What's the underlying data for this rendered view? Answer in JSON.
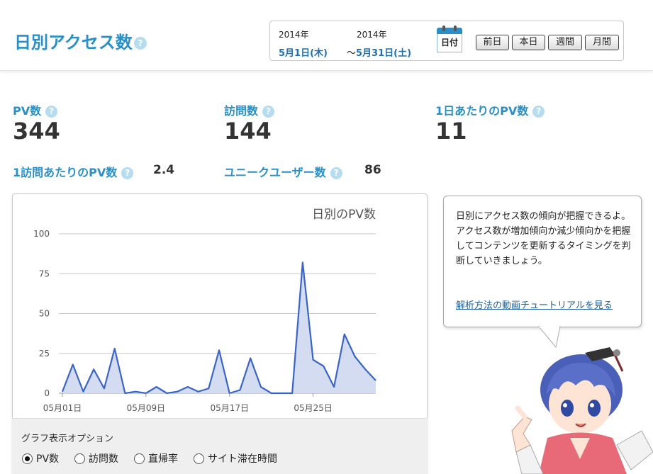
{
  "header": {
    "title": "日別アクセス数",
    "help": "?",
    "date_range": {
      "start_year": "2014年",
      "start_day": "5月1日(木)",
      "end_year": "2014年",
      "end_day": "5月31日(土)",
      "separator": "〜"
    },
    "calendar_label": "日付",
    "buttons": [
      "前日",
      "本日",
      "週間",
      "月間"
    ]
  },
  "stats": {
    "pv_label": "PV数",
    "pv_value": "344",
    "visits_label": "訪問数",
    "visits_value": "144",
    "pv_per_day_label": "1日あたりのPV数",
    "pv_per_day_value": "11",
    "pv_per_visit_label": "1訪問あたりのPV数",
    "pv_per_visit_value": "2.4",
    "unique_users_label": "ユニークユーザー数",
    "unique_users_value": "86"
  },
  "chart_data": {
    "type": "area",
    "title": "日別のPV数",
    "xlabel": "",
    "ylabel": "",
    "ylim": [
      0,
      100
    ],
    "yticks": [
      0,
      25,
      50,
      75,
      100
    ],
    "x_tick_labels": [
      {
        "label": "05月01日",
        "day": 1
      },
      {
        "label": "05月09日",
        "day": 9
      },
      {
        "label": "05月17日",
        "day": 17
      },
      {
        "label": "05月25日",
        "day": 25
      }
    ],
    "x": [
      1,
      2,
      3,
      4,
      5,
      6,
      7,
      8,
      9,
      10,
      11,
      12,
      13,
      14,
      15,
      16,
      17,
      18,
      19,
      20,
      21,
      22,
      23,
      24,
      25,
      26,
      27,
      28,
      29,
      30,
      31
    ],
    "series": [
      {
        "values": [
          1,
          18,
          1,
          15,
          3,
          28,
          0,
          1,
          0,
          4,
          0,
          1,
          4,
          1,
          3,
          27,
          0,
          2,
          22,
          4,
          0,
          0,
          0,
          82,
          21,
          17,
          4,
          37,
          23,
          15,
          8
        ]
      }
    ],
    "line_color": "#3a64c8",
    "fill_color": "#d3dcf1",
    "grid": true
  },
  "options": {
    "title": "グラフ表示オプション",
    "radios": [
      {
        "label": "PV数",
        "selected": true
      },
      {
        "label": "訪問数",
        "selected": false
      },
      {
        "label": "直帰率",
        "selected": false
      },
      {
        "label": "サイト滞在時間",
        "selected": false
      }
    ]
  },
  "tip": {
    "text": "日別にアクセス数の傾向が把握できるよ。\nアクセス数が増加傾向か減少傾向かを把握してコンテンツを更新するタイミングを判断していきましょう。",
    "link": "解析方法の動画チュートリアルを見る"
  },
  "colors": {
    "accent": "#2a8fc6",
    "help_icon": "#b6dcef"
  },
  "icons": {
    "help": "question-circle-icon",
    "calendar": "calendar-icon",
    "mascot": "mascot-character"
  }
}
